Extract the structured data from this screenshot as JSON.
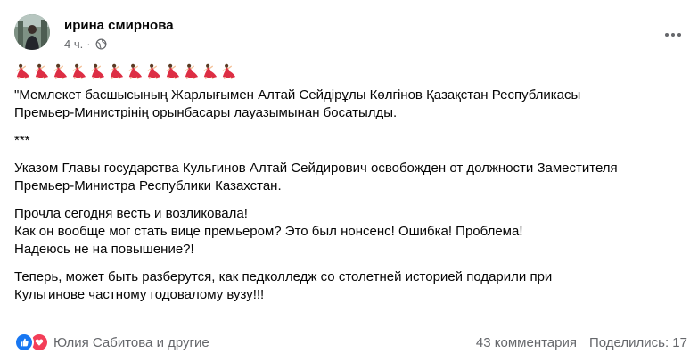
{
  "post": {
    "author": "ирина смирнова",
    "time": "4 ч.",
    "dot": "·",
    "privacy_icon": "globe-icon",
    "more_icon": "more-horizontal-icon",
    "emoji_icon": "red-dress-dancer-emoji",
    "emoji_count": 12,
    "paragraphs": [
      "\"Мемлекет басшысының Жарлығымен Алтай Сейдірұлы Көлгінов Қазақстан Республикасы\nПремьер-Министрінің орынбасары лауазымынан босатылды.",
      "***",
      "Указом Главы государства Кульгинов Алтай Сейдирович освобожден от должности Заместителя\nПремьер-Министра Республики Казахстан.",
      "Прочла сегодня весть и возликовала!\nКак он вообще мог стать вице премьером? Это был нонсенс! Ошибка! Проблема!\nНадеюсь не на повышение?!",
      "Теперь, может быть разберутся, как педколледж со столетней историей подарили при\nКульгинове частному годовалому вузу!!!"
    ]
  },
  "footer": {
    "reaction_icons": [
      "like-icon",
      "love-icon"
    ],
    "reactors": "Юлия Сабитова и другие",
    "comments": "43 комментария",
    "shares": "Поделились: 17"
  },
  "colors": {
    "text": "#050505",
    "secondary": "#65676b",
    "like": "#1877f2",
    "love": "#f33e58"
  }
}
